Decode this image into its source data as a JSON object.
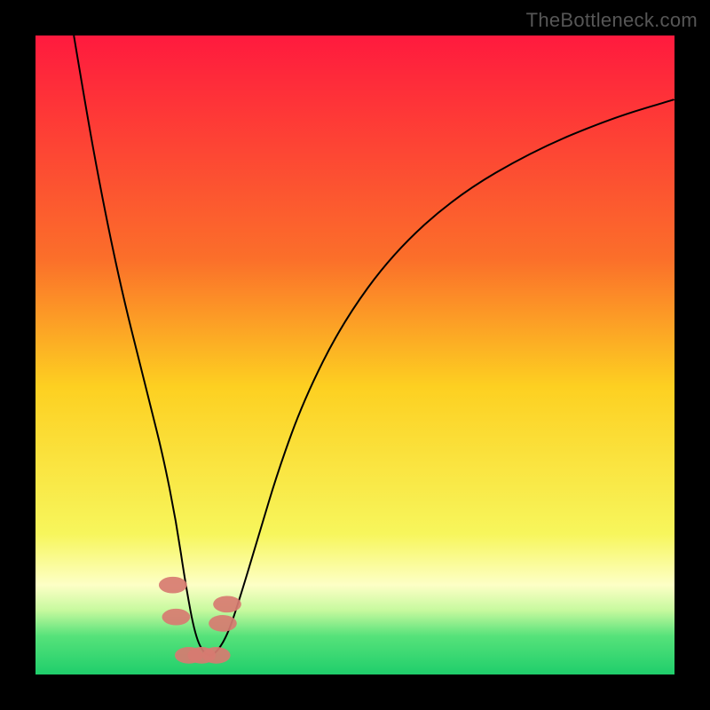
{
  "watermark": "TheBottleneck.com",
  "chart_data": {
    "type": "line",
    "title": "",
    "xlabel": "",
    "ylabel": "",
    "xlim": [
      0,
      100
    ],
    "ylim": [
      0,
      100
    ],
    "grid": false,
    "legend": false,
    "gradient_stops": [
      {
        "offset": 0,
        "color": "#ff1a3e"
      },
      {
        "offset": 35,
        "color": "#fb6f2a"
      },
      {
        "offset": 55,
        "color": "#fdd021"
      },
      {
        "offset": 78,
        "color": "#f7f65c"
      },
      {
        "offset": 86,
        "color": "#fdffc6"
      },
      {
        "offset": 90,
        "color": "#c6f99e"
      },
      {
        "offset": 94,
        "color": "#56e27a"
      },
      {
        "offset": 100,
        "color": "#1fce6b"
      }
    ],
    "series": [
      {
        "name": "bottleneck-curve",
        "color": "#000000",
        "x": [
          6,
          8,
          10,
          12,
          14,
          16,
          18,
          20,
          22,
          23.5,
          25,
          26.5,
          28,
          30,
          32,
          35,
          38,
          42,
          48,
          56,
          66,
          78,
          90,
          100
        ],
        "y": [
          100,
          88,
          77,
          67,
          58,
          50,
          42,
          34,
          24,
          14,
          6,
          3,
          3,
          6,
          12,
          22,
          32,
          43,
          55,
          66,
          75,
          82,
          87,
          90
        ]
      }
    ],
    "markers": {
      "name": "bottleneck-range-markers",
      "color": "#d77b71",
      "points": [
        {
          "x": 21.5,
          "y": 14
        },
        {
          "x": 22.0,
          "y": 9
        },
        {
          "x": 24.0,
          "y": 3
        },
        {
          "x": 26.0,
          "y": 3
        },
        {
          "x": 28.3,
          "y": 3
        },
        {
          "x": 29.3,
          "y": 8
        },
        {
          "x": 30.0,
          "y": 11
        }
      ],
      "rx": 2.2,
      "ry": 1.3
    }
  }
}
